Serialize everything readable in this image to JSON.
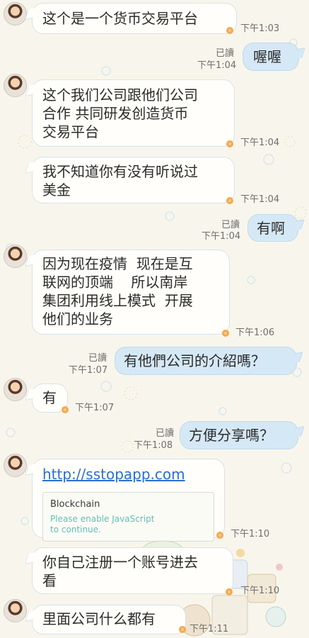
{
  "theme": {
    "bubble_in": "#fffefa",
    "bubble_out": "#d5e8f6",
    "link_color": "#2a6fd1",
    "card_desc_color": "#5fbfb5"
  },
  "messages": [
    {
      "text": "这个是一个货币交易平台",
      "time": "下午1:03"
    },
    {
      "text": "喔喔",
      "read": "已讀",
      "time": "下午1:04"
    },
    {
      "lines": [
        "这个我们公司跟他们公司",
        "合作 共同研发创造货币",
        "交易平台"
      ],
      "time": "下午1:04"
    },
    {
      "lines": [
        "我不知道你有没有听说过",
        "美金"
      ],
      "time": "下午1:04"
    },
    {
      "text": "有啊",
      "read": "已讀",
      "time": "下午1:04"
    },
    {
      "lines": [
        "因为现在疫情  现在是互",
        "联网的顶端    所以南岸",
        "集团利用线上模式  开展",
        "他们的业务"
      ],
      "time": "下午1:06"
    },
    {
      "text": "有他們公司的介紹嗎？",
      "read": "已讀",
      "time": "下午1:07"
    },
    {
      "text": "有",
      "time": "下午1:07"
    },
    {
      "text": "方便分享嗎？",
      "read": "已讀",
      "time": "下午1:08"
    },
    {
      "link": "http://sstopapp.com",
      "card_title": "Blockchain",
      "card_desc_lines": [
        "Please enable JavaScript",
        "to continue."
      ],
      "time": "下午1:10"
    },
    {
      "lines": [
        "你自己注册一个账号进去",
        "看"
      ],
      "time": "下午1:10"
    },
    {
      "text": "里面公司什么都有",
      "time": "下午1:11"
    }
  ]
}
